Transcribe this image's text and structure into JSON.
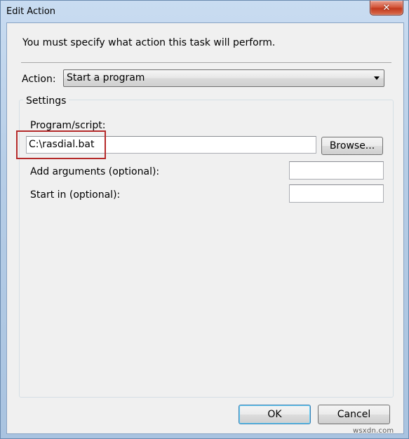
{
  "window": {
    "title": "Edit Action",
    "close_glyph": "✕"
  },
  "dialog": {
    "intro": "You must specify what action this task will perform.",
    "action_label": "Action:",
    "action_value": "Start a program",
    "settings_title": "Settings",
    "program_label": "Program/script:",
    "program_value": "C:\\rasdial.bat",
    "browse_label": "Browse...",
    "arguments_label": "Add arguments (optional):",
    "arguments_value": "",
    "startin_label": "Start in (optional):",
    "startin_value": "",
    "ok_label": "OK",
    "cancel_label": "Cancel"
  },
  "watermark": "wsxdn.com"
}
